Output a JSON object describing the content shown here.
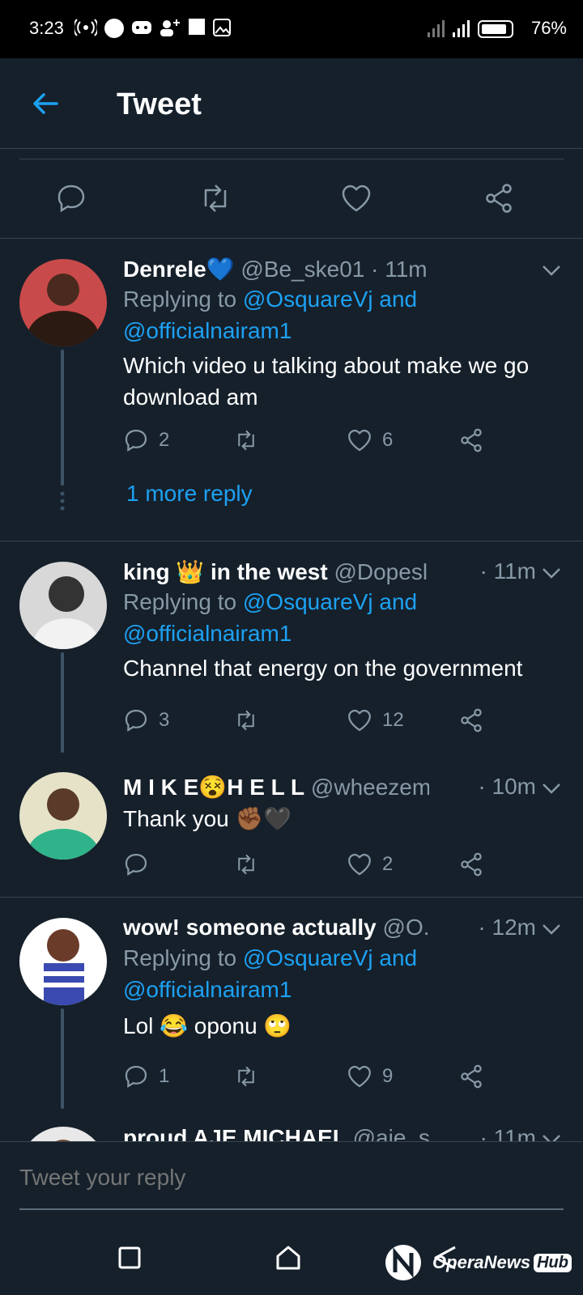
{
  "statusbar": {
    "time": "3:23",
    "battery": "76%"
  },
  "header": {
    "title": "Tweet"
  },
  "tweets": [
    {
      "name": "Denrele💙",
      "handle": "@Be_ske01 · 11m",
      "time": "",
      "replying_prefix": "Replying to ",
      "replying_link1": "@OsquareVj and",
      "replying_link2": "@officialnairam1",
      "body_line1": "Which video u talking about make we go",
      "body_line2": "download am",
      "replies": "2",
      "retweets": "",
      "likes": "6",
      "more": "1 more reply",
      "avatar_color": "#6b3b2a"
    },
    {
      "name": "king 👑 in the west",
      "handle": "@Dopesl...",
      "time": "· 11m",
      "replying_prefix": "Replying to ",
      "replying_link1": "@OsquareVj and",
      "replying_link2": "@officialnairam1",
      "body_line1": "Channel that energy on the government",
      "replies": "3",
      "retweets": "",
      "likes": "12",
      "avatar_color": "#9a9a9a"
    },
    {
      "name": "M I K E😵H E L L",
      "handle": "@wheezemi...",
      "time": "· 10m",
      "body_line1": "Thank you ✊🏾🖤",
      "replies": "",
      "retweets": "",
      "likes": "2",
      "avatar_color": "#2e8b57"
    },
    {
      "name": "wow! someone actually",
      "handle": "@O...",
      "time": "· 12m",
      "replying_prefix": "Replying to ",
      "replying_link1": "@OsquareVj and",
      "replying_link2": "@officialnairam1",
      "body_line1": "Lol 😂 oponu 🙄",
      "replies": "1",
      "retweets": "",
      "likes": "9",
      "avatar_color": "#c0392b"
    },
    {
      "name": "proud AJE MICHAEL",
      "handle": "@aje_s...",
      "time": "· 11m"
    }
  ],
  "composer": {
    "placeholder": "Tweet your reply"
  },
  "watermark": {
    "text": "OperaNews",
    "hub": "Hub"
  },
  "colors": {
    "background": "#15202b",
    "accent": "#1da1f2",
    "muted": "#8899a6",
    "divider": "#38444d"
  }
}
